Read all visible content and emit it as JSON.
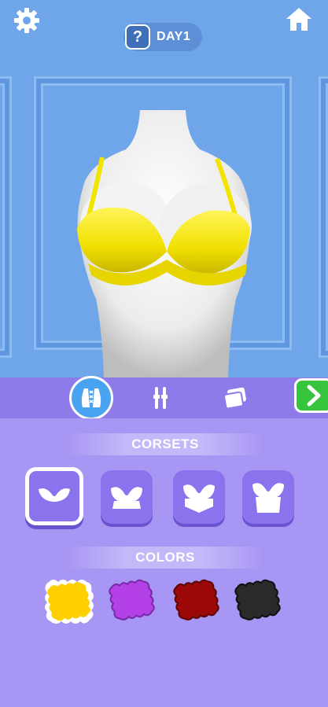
{
  "topbar": {
    "settings_icon": "gear-icon",
    "home_icon": "home-icon",
    "help_label": "?",
    "day_label": "DAY1"
  },
  "tabs": [
    {
      "name": "corset",
      "icon": "corset-icon",
      "active": true
    },
    {
      "name": "straps",
      "icon": "straps-icon",
      "active": false
    },
    {
      "name": "fabric",
      "icon": "fabric-icon",
      "active": false
    }
  ],
  "next_icon": "chevron-right-icon",
  "corsets": {
    "title": "CORSETS",
    "items": [
      "bra-style-1",
      "bra-style-2",
      "bra-style-3",
      "bra-style-4"
    ],
    "selected_index": 0
  },
  "colors": {
    "title": "COLORS",
    "swatches": [
      "#ffd000",
      "#b440e8",
      "#9c0808",
      "#2a2a2a"
    ],
    "selected_index": 0
  },
  "colors_theme": {
    "wall": "#6fa6ea",
    "panel": "#a896f4",
    "tabbar": "#8e7ae8",
    "accent_green": "#37c43d",
    "bra_yellow": "#f5e600"
  }
}
